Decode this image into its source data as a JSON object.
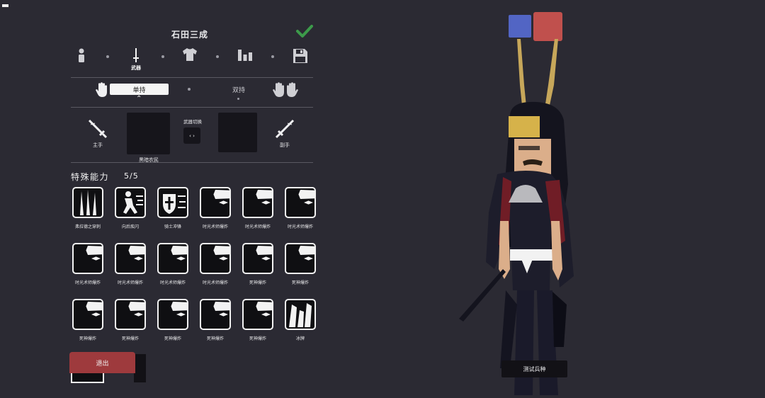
{
  "header": {
    "title": "石田三成"
  },
  "steps": [
    {
      "icon": "person-icon",
      "label": ""
    },
    {
      "icon": "sword-icon",
      "label": "武器"
    },
    {
      "icon": "shirt-icon",
      "label": ""
    },
    {
      "icon": "bar-chart-icon",
      "label": ""
    },
    {
      "icon": "save-icon",
      "label": ""
    }
  ],
  "hold_mode": {
    "selected_label": "单持",
    "other_label": "双持"
  },
  "weapons": {
    "main_hand_label": "主手",
    "main_slot_name": "黑暗农民",
    "swap_label": "武器切换",
    "swap_symbol": "‹ ›",
    "off_hand_label": "副手"
  },
  "abilities": {
    "title": "特殊能力",
    "count": "5/5",
    "items": [
      {
        "label": "弗拉德之穿刺",
        "icon": "spikes-icon"
      },
      {
        "label": "向后疾闪",
        "icon": "dash-back-icon"
      },
      {
        "label": "骑士冲锋",
        "icon": "knight-charge-icon"
      },
      {
        "label": "时光术师爆炸",
        "icon": "burst-icon"
      },
      {
        "label": "时光术师爆炸",
        "icon": "burst-icon"
      },
      {
        "label": "时光术师爆炸",
        "icon": "burst-icon"
      },
      {
        "label": "时光术师爆炸",
        "icon": "burst-icon"
      },
      {
        "label": "时光术师爆炸",
        "icon": "burst-icon"
      },
      {
        "label": "时光术师爆炸",
        "icon": "burst-icon"
      },
      {
        "label": "时光术师爆炸",
        "icon": "burst-icon"
      },
      {
        "label": "死神爆炸",
        "icon": "burst-icon"
      },
      {
        "label": "死神爆炸",
        "icon": "burst-icon"
      },
      {
        "label": "死神爆炸",
        "icon": "burst-icon"
      },
      {
        "label": "死神爆炸",
        "icon": "burst-icon"
      },
      {
        "label": "死神爆炸",
        "icon": "burst-icon"
      },
      {
        "label": "死神爆炸",
        "icon": "burst-icon"
      },
      {
        "label": "死神爆炸",
        "icon": "burst-icon"
      },
      {
        "label": "冰牌",
        "icon": "ice-icon"
      }
    ]
  },
  "footer": {
    "exit_label": "退出",
    "test_label": "测试兵种"
  },
  "colors": {
    "background": "#2b2a33",
    "exit_button": "#9e3a3d",
    "team_blue": "#5265c4",
    "team_red": "#c0504d",
    "confirm_check": "#3c9a4a"
  }
}
